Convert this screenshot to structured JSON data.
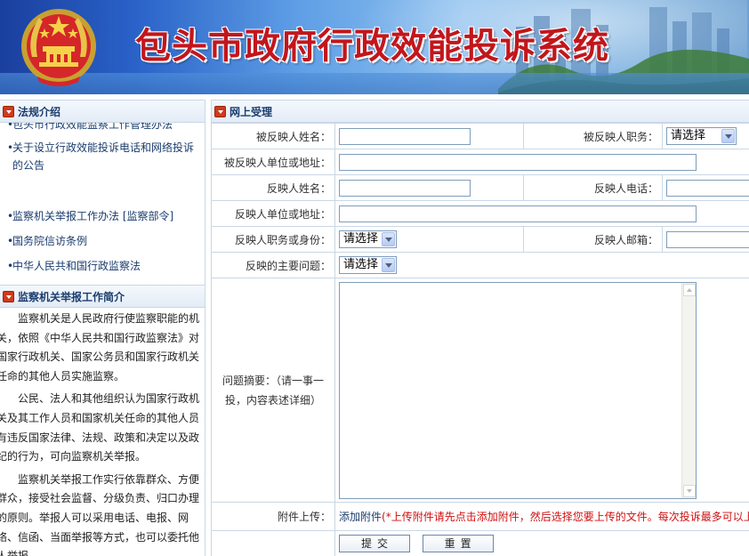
{
  "banner": {
    "title": "包头市政府行政效能投诉系统"
  },
  "left": {
    "laws_title": "法规介绍",
    "laws": [
      "包头市行政效能监察工作管理办法",
      "关于设立行政效能投诉电话和网络投诉的公告",
      "监察机关举报工作办法 [监察部令]",
      "国务院信访条例",
      "中华人民共和国行政监察法"
    ],
    "bullet": "•",
    "intro_title": "监察机关举报工作简介",
    "intro_paragraphs": [
      "监察机关是人民政府行使监察职能的机关，依照《中华人民共和国行政监察法》对国家行政机关、国家公务员和国家行政机关任命的其他人员实施监察。",
      "公民、法人和其他组织认为国家行政机关及其工作人员和国家机关任命的其他人员有违反国家法律、法规、政策和决定以及政纪的行为，可向监察机关举报。",
      "监察机关举报工作实行依靠群众、方便群众，接受社会监督、分级负责、归口办理的原则。举报人可以采用电话、电报、网络、信函、当面举报等方式，也可以委托他人举报。"
    ]
  },
  "form": {
    "title": "网上受理",
    "labels": {
      "respondent_name": "被反映人姓名：",
      "respondent_post": "被反映人职务：",
      "respondent_unit": "被反映人单位或地址：",
      "reporter_name": "反映人姓名：",
      "reporter_phone": "反映人电话：",
      "reporter_unit": "反映人单位或地址：",
      "reporter_post": "反映人职务或身份：",
      "reporter_email": "反映人邮箱：",
      "main_issue": "反映的主要问题：",
      "summary_line1": "问题摘要：（请一事一",
      "summary_line2": "投，内容表述详细）",
      "attachment": "附件上传："
    },
    "select_default": "请选择",
    "attachment_link": "添加附件",
    "attachment_note": "(*上传附件请先点击添加附件，然后选择您要上传的文件。每次投诉最多可以上传",
    "submit": "提交",
    "reset": "重置"
  }
}
